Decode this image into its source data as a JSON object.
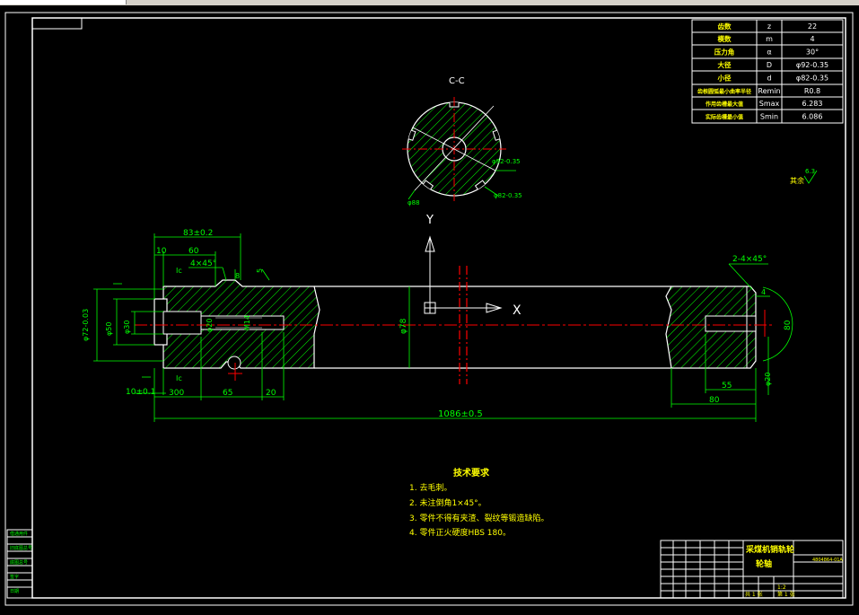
{
  "section_title": "C-C",
  "axes": {
    "y": "Y",
    "x": "X"
  },
  "params": [
    [
      "齿数",
      "z",
      "22"
    ],
    [
      "模数",
      "m",
      "4"
    ],
    [
      "压力角",
      "α",
      "30°"
    ],
    [
      "大径",
      "D",
      "φ92-0.35"
    ],
    [
      "小径",
      "d",
      "φ82-0.35"
    ],
    [
      "齿根圆弧最小曲率半径",
      "Remin",
      "R0.8"
    ],
    [
      "作用齿槽最大值",
      "Smax",
      "6.283"
    ],
    [
      "实际齿槽最小值",
      "Smin",
      "6.086"
    ]
  ],
  "dims": {
    "d83": "83±0.2",
    "d10": "10",
    "d60": "60",
    "d4x45": "4×45°",
    "d8": "8",
    "d5": "5",
    "phi72": "φ72-0.03",
    "phi50": "φ50",
    "phi30": "φ30",
    "phi20": "φ20",
    "m14": "M14",
    "phi78": "φ78",
    "d10b": "10±0.1",
    "d300": "300",
    "d65": "65",
    "d20": "20",
    "d1086": "1086±0.5",
    "d2x45": "2-4×45°",
    "d4": "4",
    "d80a": "80",
    "d55": "55",
    "d80b": "80",
    "phi20b": "φ20",
    "phi88": "φ88",
    "phi82": "φ82-0.35",
    "phi92": "φ92-0.35",
    "ic1": "Ic",
    "ic2": "Ic",
    "rough": "6.3",
    "rough_label": "其余"
  },
  "tech": {
    "title": "技术要求",
    "items": [
      "1.  去毛刺。",
      "2.  未注倒角1×45°。",
      "3.  零件不得有夹渣、裂纹等锻造缺陷。",
      "4.  零件正火硬度HBS 180。"
    ]
  },
  "titleblock": {
    "name1": "采煤机销轨轮",
    "name2": "轮轴",
    "code": "4804864-01A",
    "scale": "1:2",
    "sheets": "共 1 张",
    "sheet_no": "第 1 张"
  },
  "colors": {
    "frame": "#ffffff",
    "dim": "#00ff00",
    "hatch": "#00ff00",
    "text": "#ffff00",
    "center": "#ff0000"
  }
}
